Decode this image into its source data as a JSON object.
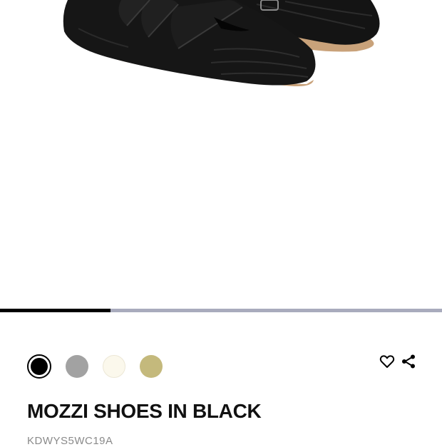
{
  "carousel": {
    "progress": 0.25
  },
  "swatches": [
    {
      "name": "black",
      "color": "#000000",
      "selected": true
    },
    {
      "name": "gray",
      "color": "#a2a2a2",
      "selected": false
    },
    {
      "name": "cream",
      "color": "#fbf8ec",
      "selected": false
    },
    {
      "name": "khaki",
      "color": "#c4b97c",
      "selected": false
    }
  ],
  "actions": {
    "wishlist_icon": "heart-outline-icon",
    "share_icon": "share-icon"
  },
  "product": {
    "title": "MOZZI SHOES IN BLACK",
    "sku": "KDWYS5WC19A"
  },
  "colors": {
    "track": "#a9abbd",
    "indicator": "#000000",
    "title": "#111111",
    "sku": "#8a8a8a"
  }
}
